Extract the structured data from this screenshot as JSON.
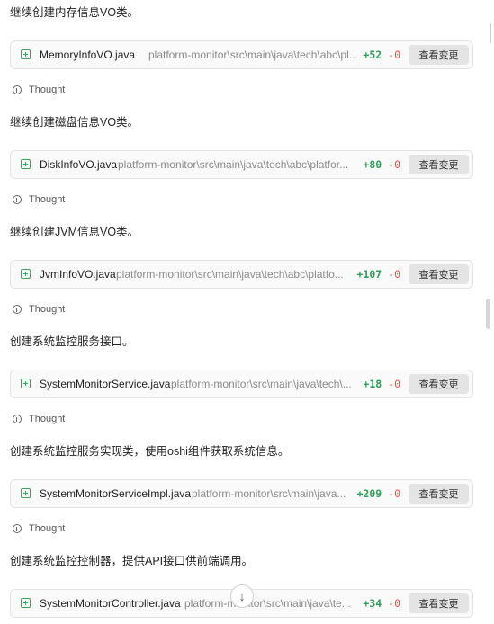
{
  "entries": [
    {
      "message": "继续创建内存信息VO类。",
      "file_name": "MemoryInfoVO.java",
      "file_path": "platform-monitor\\src\\main\\java\\tech\\abc\\pl...",
      "additions": "+52",
      "deletions": "-0",
      "view_label": "查看变更",
      "thought_label": "Thought"
    },
    {
      "message": "继续创建磁盘信息VO类。",
      "file_name": "DiskInfoVO.java",
      "file_path": "platform-monitor\\src\\main\\java\\tech\\abc\\platfor...",
      "additions": "+80",
      "deletions": "-0",
      "view_label": "查看变更",
      "thought_label": "Thought"
    },
    {
      "message": "继续创建JVM信息VO类。",
      "file_name": "JvmInfoVO.java",
      "file_path": "platform-monitor\\src\\main\\java\\tech\\abc\\platfo...",
      "additions": "+107",
      "deletions": "-0",
      "view_label": "查看变更",
      "thought_label": "Thought"
    },
    {
      "message": "创建系统监控服务接口。",
      "file_name": "SystemMonitorService.java",
      "file_path": "platform-monitor\\src\\main\\java\\tech\\...",
      "additions": "+18",
      "deletions": "-0",
      "view_label": "查看变更",
      "thought_label": "Thought"
    },
    {
      "message": "创建系统监控服务实现类，使用oshi组件获取系统信息。",
      "file_name": "SystemMonitorServiceImpl.java",
      "file_path": "platform-monitor\\src\\main\\java...",
      "additions": "+209",
      "deletions": "-0",
      "view_label": "查看变更",
      "thought_label": "Thought"
    },
    {
      "message": "创建系统监控控制器，提供API接口供前端调用。",
      "file_name": "SystemMonitorController.java",
      "file_path": "platform-monitor\\src\\main\\java\\te...",
      "additions": "+34",
      "deletions": "-0",
      "view_label": "查看变更",
      "thought_label": ""
    }
  ],
  "scroll_down_icon": "arrow-down-icon",
  "scroll_down_glyph": "↓",
  "colors": {
    "additions": "#2f9e55",
    "deletions": "#e0504a",
    "file_icon": "#3aa55a"
  }
}
